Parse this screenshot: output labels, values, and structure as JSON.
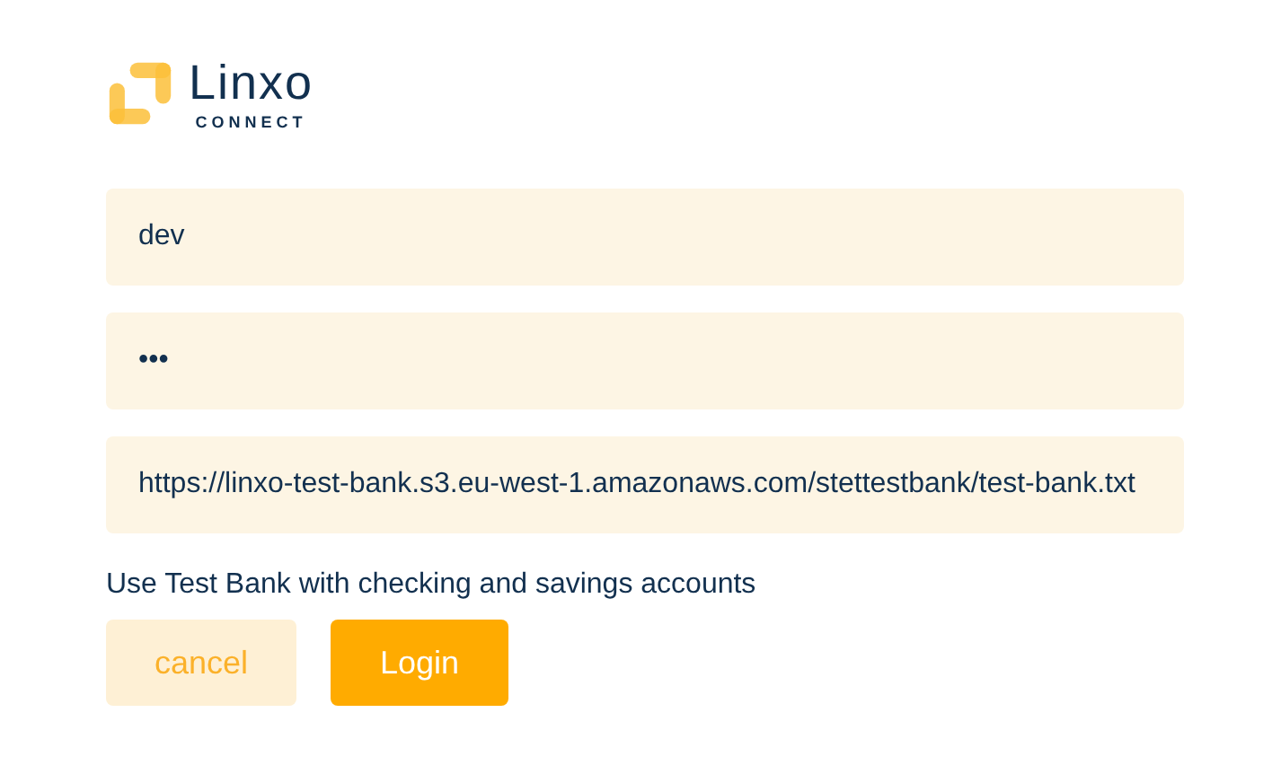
{
  "logo": {
    "name": "Linxo",
    "tagline": "CONNECT"
  },
  "fields": [
    {
      "value": "dev"
    },
    {
      "value": "•••"
    },
    {
      "value": "https://linxo-test-bank.s3.eu-west-1.amazonaws.com/stettestbank/test-bank.txt"
    }
  ],
  "note": "Use Test Bank with checking and savings accounts",
  "buttons": [
    {
      "label": "cancel",
      "kind": "secondary"
    },
    {
      "label": "Login",
      "kind": "primary"
    }
  ]
}
